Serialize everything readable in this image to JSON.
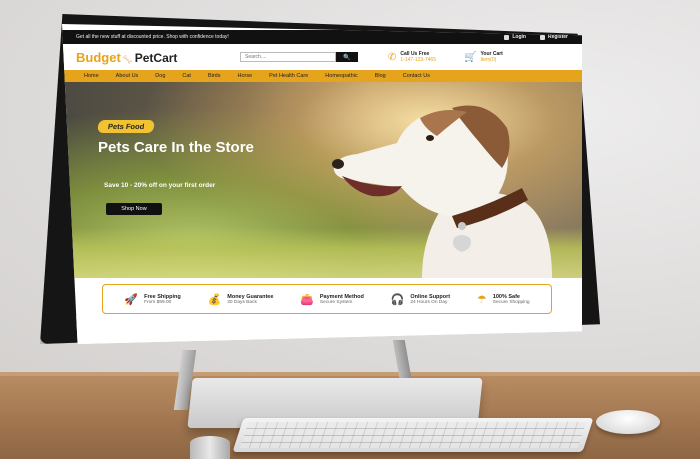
{
  "topbar": {
    "promo": "Get all the new stuff at discounted price. Shop with confidence today!",
    "login": "Login",
    "register": "Register"
  },
  "header": {
    "logo_part1": "Budget",
    "logo_part2": "PetCart",
    "search_placeholder": "Search....",
    "search_button": "🔍",
    "call_label": "Call Us Free",
    "call_number": "1-147-123-7465",
    "cart_label": "Your Cart",
    "cart_amount": "Item(0)"
  },
  "nav": [
    "Home",
    "About Us",
    "Dog",
    "Cat",
    "Birds",
    "Horse",
    "Pet Health Care",
    "Homeopathic",
    "Blog",
    "Contact Us"
  ],
  "hero": {
    "tag": "Pets Food",
    "title": "Pets Care In the Store",
    "subtitle": "Save 10 - 20% off on your first order",
    "cta": "Shop Now"
  },
  "features": [
    {
      "title": "Free Shipping",
      "sub": "From $99.00",
      "icon": "rocket-icon"
    },
    {
      "title": "Money Guarantee",
      "sub": "30 Days Back",
      "icon": "money-bag-icon"
    },
    {
      "title": "Payment Method",
      "sub": "Secure System",
      "icon": "wallet-icon"
    },
    {
      "title": "Online Support",
      "sub": "24 Hours On Day",
      "icon": "headset-icon"
    },
    {
      "title": "100% Safe",
      "sub": "Secure Shopping",
      "icon": "umbrella-icon"
    }
  ],
  "colors": {
    "accent": "#e6a31c",
    "dark": "#111111"
  }
}
